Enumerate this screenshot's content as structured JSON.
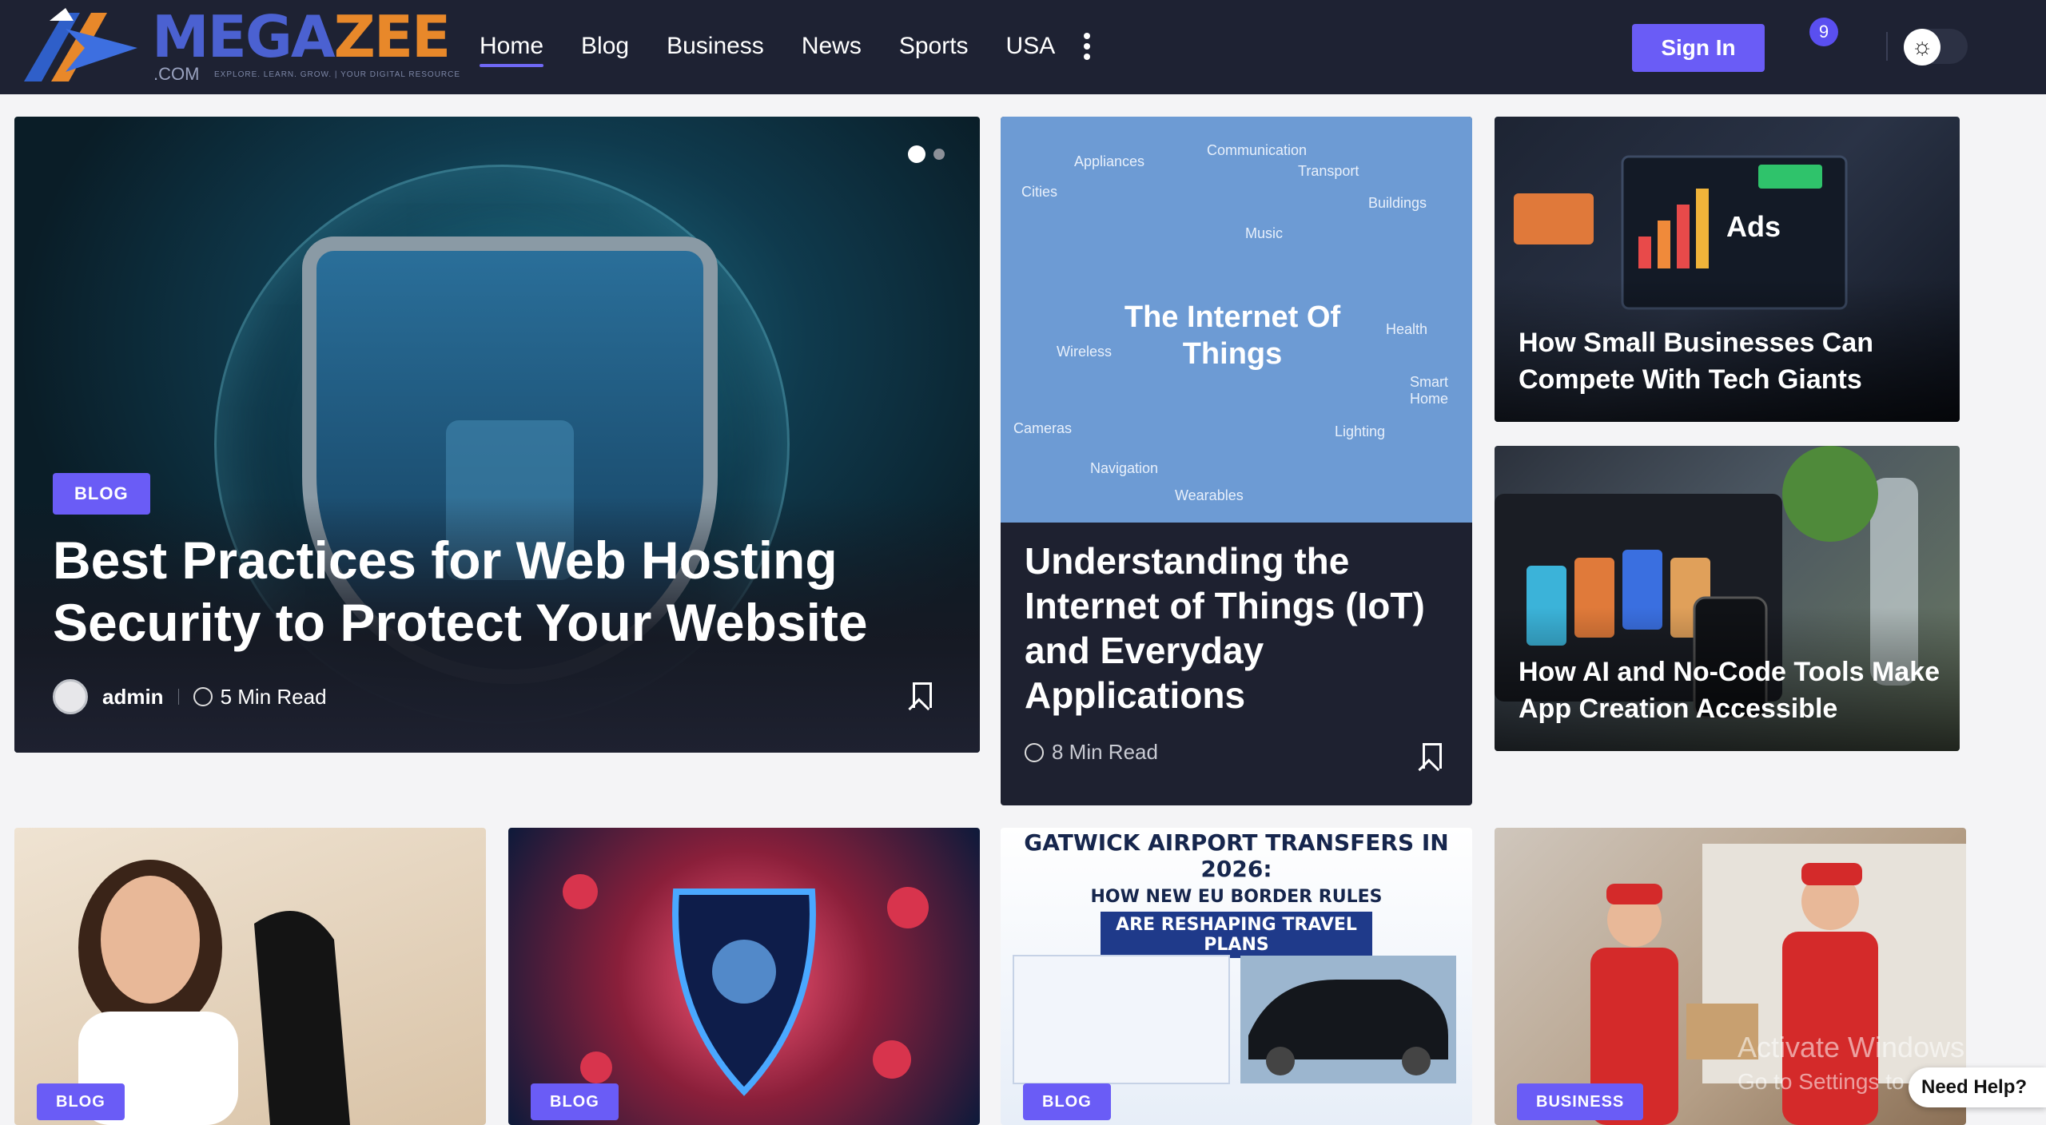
{
  "brand": {
    "name_part1": "MEGA",
    "name_part2": "ZEE",
    "domain_suffix": ".COM",
    "tagline": "EXPLORE. LEARN. GROW. | YOUR DIGITAL RESOURCE",
    "colors": {
      "primary": "#4b61d1",
      "accent": "#e8882a"
    }
  },
  "nav": {
    "items": [
      {
        "label": "Home",
        "active": true
      },
      {
        "label": "Blog",
        "active": false
      },
      {
        "label": "Business",
        "active": false
      },
      {
        "label": "News",
        "active": false
      },
      {
        "label": "Sports",
        "active": false
      },
      {
        "label": "USA",
        "active": false
      }
    ],
    "more_icon": "more-vertical-icon"
  },
  "header": {
    "sign_in_label": "Sign In",
    "notification_count": "9",
    "theme_icon": "sun-icon",
    "accent_color": "#6a5cf6"
  },
  "hero": {
    "category": "BLOG",
    "title": "Best Practices for Web Hosting Security to Protect Your Website",
    "author": "admin",
    "read_time": "5 Min Read"
  },
  "iot_card": {
    "image_title": "The Internet Of Things",
    "image_words": [
      "Appliances",
      "Communication",
      "Transport",
      "Cities",
      "Buildings",
      "Music",
      "Health",
      "Wireless",
      "Cameras",
      "Navigation",
      "Wearables",
      "Lighting",
      "Smart Home"
    ],
    "title": "Understanding the Internet of Things (IoT) and Everyday Applications",
    "read_time": "8 Min Read"
  },
  "side_cards": [
    {
      "title": "How Small Businesses Can Compete With Tech Giants"
    },
    {
      "title": "How AI and No-Code Tools Make App Creation Accessible"
    }
  ],
  "bottom_cards": [
    {
      "category": "BLOG"
    },
    {
      "category": "BLOG"
    },
    {
      "category": "BLOG",
      "headline": "GATWICK AIRPORT TRANSFERS IN 2026:",
      "subhead": "HOW NEW EU BORDER RULES",
      "banner": "ARE RESHAPING TRAVEL PLANS"
    },
    {
      "category": "BUSINESS"
    }
  ],
  "overlay": {
    "activate_title": "Activate Windows",
    "activate_sub": "Go to Settings to activate Windows.",
    "need_help": "Need Help?"
  }
}
